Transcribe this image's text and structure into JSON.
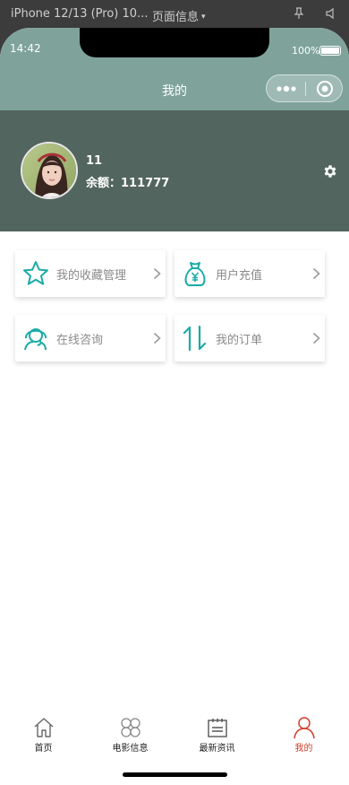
{
  "simulator": {
    "device_label": "iPhone 12/13 (Pro) 10...",
    "page_label": "页面信息",
    "page_caret": "▾"
  },
  "status_bar": {
    "time": "14:42",
    "battery_text": "100%",
    "battery_level": 1.0
  },
  "nav": {
    "title": "我的",
    "background_color": "#7fa39b"
  },
  "profile": {
    "name": "11",
    "balance_label": "余额：",
    "balance_value": "111777",
    "background_color": "#53655f"
  },
  "menu": {
    "accent_color": "#1aaba7",
    "items": [
      {
        "label": "我的收藏管理",
        "icon": "star-icon"
      },
      {
        "label": "用户充值",
        "icon": "money-bag-icon"
      },
      {
        "label": "在线咨询",
        "icon": "consult-icon"
      },
      {
        "label": "我的订单",
        "icon": "sort-arrows-icon"
      }
    ]
  },
  "tabbar": {
    "active_color": "#d23c2a",
    "tabs": [
      {
        "label": "首页",
        "icon": "home-icon",
        "active": false
      },
      {
        "label": "电影信息",
        "icon": "grid-icon",
        "active": false
      },
      {
        "label": "最新资讯",
        "icon": "calendar-icon",
        "active": false
      },
      {
        "label": "我的",
        "icon": "person-icon",
        "active": true
      }
    ]
  }
}
